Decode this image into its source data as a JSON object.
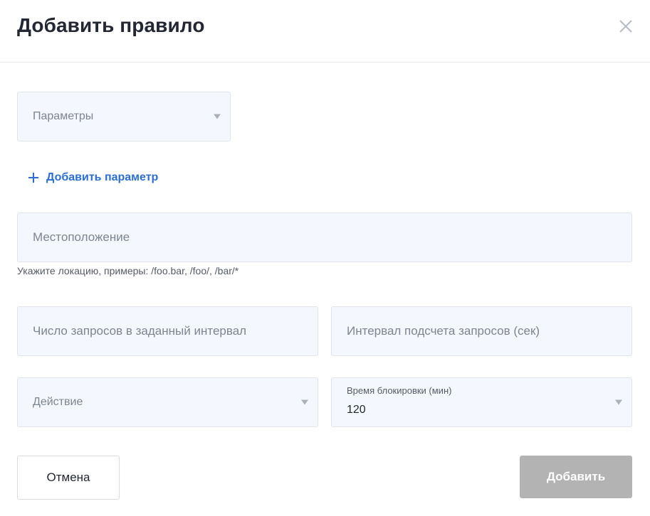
{
  "dialog": {
    "title": "Добавить правило"
  },
  "form": {
    "params_select": {
      "placeholder": "Параметры"
    },
    "add_param_label": "Добавить параметр",
    "location": {
      "placeholder": "Местоположение",
      "hint": "Укажите локацию, примеры: /foo.bar, /foo/, /bar/*"
    },
    "requests_count": {
      "placeholder": "Число запросов в заданный интервал"
    },
    "requests_interval": {
      "placeholder": "Интервал подсчета запросов (сек)"
    },
    "action_select": {
      "placeholder": "Действие"
    },
    "block_time": {
      "label": "Время блокировки (мин)",
      "value": "120"
    }
  },
  "buttons": {
    "cancel_label": "Отмена",
    "add_label": "Добавить"
  },
  "colors": {
    "accent": "#2a6fd6",
    "field_bg": "#f4f7fe",
    "disabled_button": "#b3b3b3"
  },
  "icons": {
    "close": "close-icon",
    "plus": "plus-icon",
    "dropdown": "chevron-down-icon"
  }
}
